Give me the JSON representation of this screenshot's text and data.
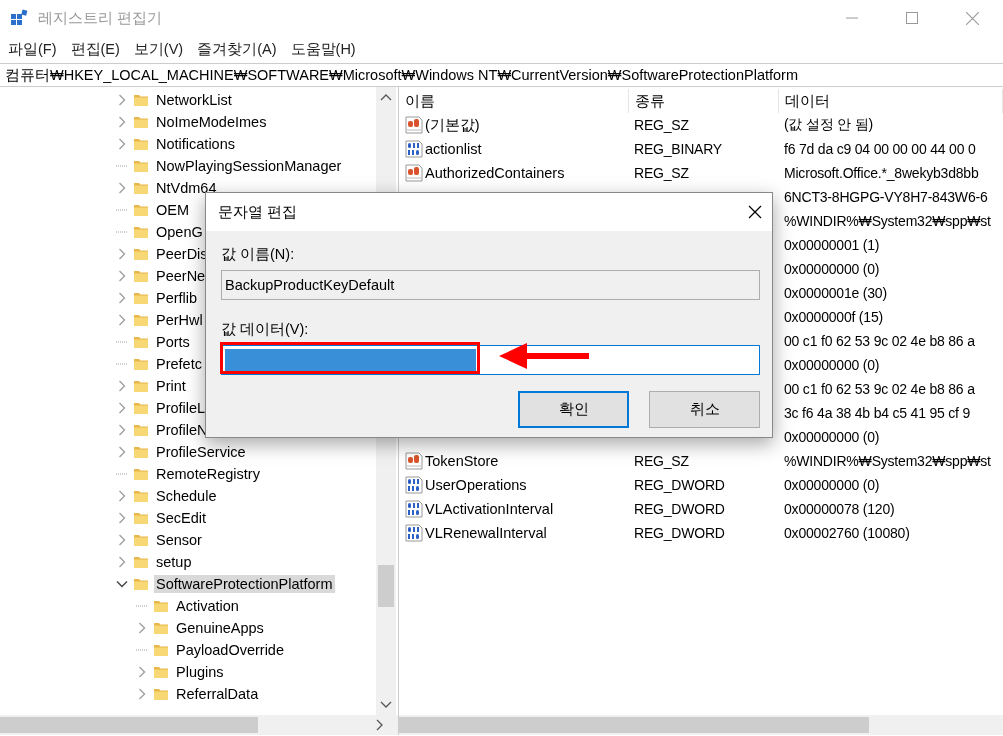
{
  "window": {
    "title": "레지스트리 편집기"
  },
  "menu": [
    "파일(F)",
    "편집(E)",
    "보기(V)",
    "즐겨찾기(A)",
    "도움말(H)"
  ],
  "address": "컴퓨터₩HKEY_LOCAL_MACHINE₩SOFTWARE₩Microsoft₩Windows NT₩CurrentVersion₩SoftwareProtectionPlatform",
  "tree": [
    {
      "label": "NetworkList",
      "leaf": false,
      "expanded": false,
      "selected": false
    },
    {
      "label": "NoImeModeImes",
      "leaf": false,
      "expanded": false,
      "selected": false
    },
    {
      "label": "Notifications",
      "leaf": false,
      "expanded": false,
      "selected": false
    },
    {
      "label": "NowPlayingSessionManager",
      "leaf": true,
      "selected": false
    },
    {
      "label": "NtVdm64",
      "leaf": false,
      "expanded": false,
      "selected": false
    },
    {
      "label": "OEM",
      "leaf": true,
      "selected": false
    },
    {
      "label": "OpenG",
      "leaf": true,
      "selected": false
    },
    {
      "label": "PeerDis",
      "leaf": false,
      "expanded": false,
      "selected": false
    },
    {
      "label": "PeerNe",
      "leaf": false,
      "expanded": false,
      "selected": false
    },
    {
      "label": "Perflib",
      "leaf": false,
      "expanded": false,
      "selected": false
    },
    {
      "label": "PerHwl",
      "leaf": false,
      "expanded": false,
      "selected": false
    },
    {
      "label": "Ports",
      "leaf": true,
      "selected": false
    },
    {
      "label": "Prefetc",
      "leaf": true,
      "selected": false
    },
    {
      "label": "Print",
      "leaf": false,
      "expanded": false,
      "selected": false
    },
    {
      "label": "ProfileL",
      "leaf": false,
      "expanded": false,
      "selected": false
    },
    {
      "label": "ProfileN",
      "leaf": false,
      "expanded": false,
      "selected": false
    },
    {
      "label": "ProfileService",
      "leaf": false,
      "expanded": false,
      "selected": false
    },
    {
      "label": "RemoteRegistry",
      "leaf": true,
      "selected": false
    },
    {
      "label": "Schedule",
      "leaf": false,
      "expanded": false,
      "selected": false
    },
    {
      "label": "SecEdit",
      "leaf": false,
      "expanded": false,
      "selected": false
    },
    {
      "label": "Sensor",
      "leaf": false,
      "expanded": false,
      "selected": false
    },
    {
      "label": "setup",
      "leaf": false,
      "expanded": false,
      "selected": false
    },
    {
      "label": "SoftwareProtectionPlatform",
      "leaf": false,
      "expanded": true,
      "selected": true,
      "children": [
        {
          "label": "Activation",
          "leaf": true,
          "selected": false
        },
        {
          "label": "GenuineApps",
          "leaf": false,
          "expanded": false,
          "selected": false
        },
        {
          "label": "PayloadOverride",
          "leaf": true,
          "selected": false
        },
        {
          "label": "Plugins",
          "leaf": false,
          "expanded": false,
          "selected": false
        },
        {
          "label": "ReferralData",
          "leaf": false,
          "expanded": false,
          "selected": false
        }
      ]
    }
  ],
  "values": {
    "columns": [
      "이름",
      "종류",
      "데이터"
    ],
    "rows": [
      {
        "kind": "string",
        "name": "(기본값)",
        "type": "REG_SZ",
        "data": "(값 설정 안 됨)"
      },
      {
        "kind": "binary",
        "name": "actionlist",
        "type": "REG_BINARY",
        "data": "f6 7d da c9 04 00 00 00 44 00 0"
      },
      {
        "kind": "string",
        "name": "AuthorizedContainers",
        "type": "REG_SZ",
        "data": "Microsoft.Office.*_8wekyb3d8bb"
      },
      {
        "data": "6NCT3-8HGPG-VY8H7-843W6-6"
      },
      {
        "data": "%WINDIR%₩System32₩spp₩st"
      },
      {
        "data": "0x00000001 (1)"
      },
      {
        "data": "0x00000000 (0)"
      },
      {
        "data": "0x0000001e (30)"
      },
      {
        "data": "0x0000000f (15)"
      },
      {
        "data": "00 c1 f0 62 53 9c 02 4e b8 86 a"
      },
      {
        "data": "0x00000000 (0)"
      },
      {
        "data": "00 c1 f0 62 53 9c 02 4e b8 86 a"
      },
      {
        "data": "3c f6 4a 38 4b b4 c5 41 95 cf 9"
      },
      {
        "data": "0x00000000 (0)"
      },
      {
        "kind": "string",
        "name": "TokenStore",
        "type": "REG_SZ",
        "data": "%WINDIR%₩System32₩spp₩st"
      },
      {
        "kind": "binary",
        "name": "UserOperations",
        "type": "REG_DWORD",
        "data": "0x00000000 (0)"
      },
      {
        "kind": "binary",
        "name": "VLActivationInterval",
        "type": "REG_DWORD",
        "data": "0x00000078 (120)"
      },
      {
        "kind": "binary",
        "name": "VLRenewalInterval",
        "type": "REG_DWORD",
        "data": "0x00002760 (10080)"
      }
    ]
  },
  "dialog": {
    "title": "문자열 편집",
    "name_label": "값 이름(N):",
    "name_value": "BackupProductKeyDefault",
    "data_label": "값 데이터(V):",
    "data_redacted": true,
    "buttons": [
      {
        "label": "확인",
        "default": true
      },
      {
        "label": "취소",
        "default": false
      }
    ]
  },
  "annotations": {
    "highlight_box": {
      "color": "#ff0000"
    },
    "arrow": {
      "color": "#ff0000"
    }
  }
}
